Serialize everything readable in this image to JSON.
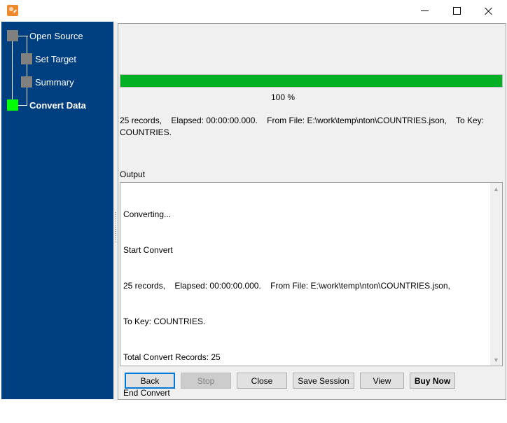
{
  "window": {
    "title": "",
    "icon": "app-logo-icon",
    "controls": {
      "minimize": "minimize-icon",
      "maximize": "maximize-icon",
      "close": "close-icon"
    }
  },
  "sidebar": {
    "background": "#003f7f",
    "steps": [
      {
        "label": "Open Source",
        "status": "done",
        "color": "#808080"
      },
      {
        "label": "Set Target",
        "status": "done",
        "color": "#808080"
      },
      {
        "label": "Summary",
        "status": "done",
        "color": "#808080"
      },
      {
        "label": "Convert Data",
        "status": "current",
        "color": "#00ff00"
      }
    ]
  },
  "progress": {
    "percent": 100,
    "label": "100 %",
    "color": "#06b025"
  },
  "status": {
    "text": "25 records,    Elapsed: 00:00:00.000.    From File: E:\\work\\temp\\nton\\COUNTRIES.json,    To Key: COUNTRIES."
  },
  "output": {
    "label": "Output",
    "lines": [
      "Converting...",
      "Start Convert",
      "25 records,    Elapsed: 00:00:00.000.    From File: E:\\work\\temp\\nton\\COUNTRIES.json,",
      "To Key: COUNTRIES.",
      "Total Convert Records: 25",
      "End Convert"
    ]
  },
  "buttons": {
    "back": "Back",
    "stop": "Stop",
    "close": "Close",
    "save_session": "Save Session",
    "view": "View",
    "buy_now": "Buy Now"
  }
}
